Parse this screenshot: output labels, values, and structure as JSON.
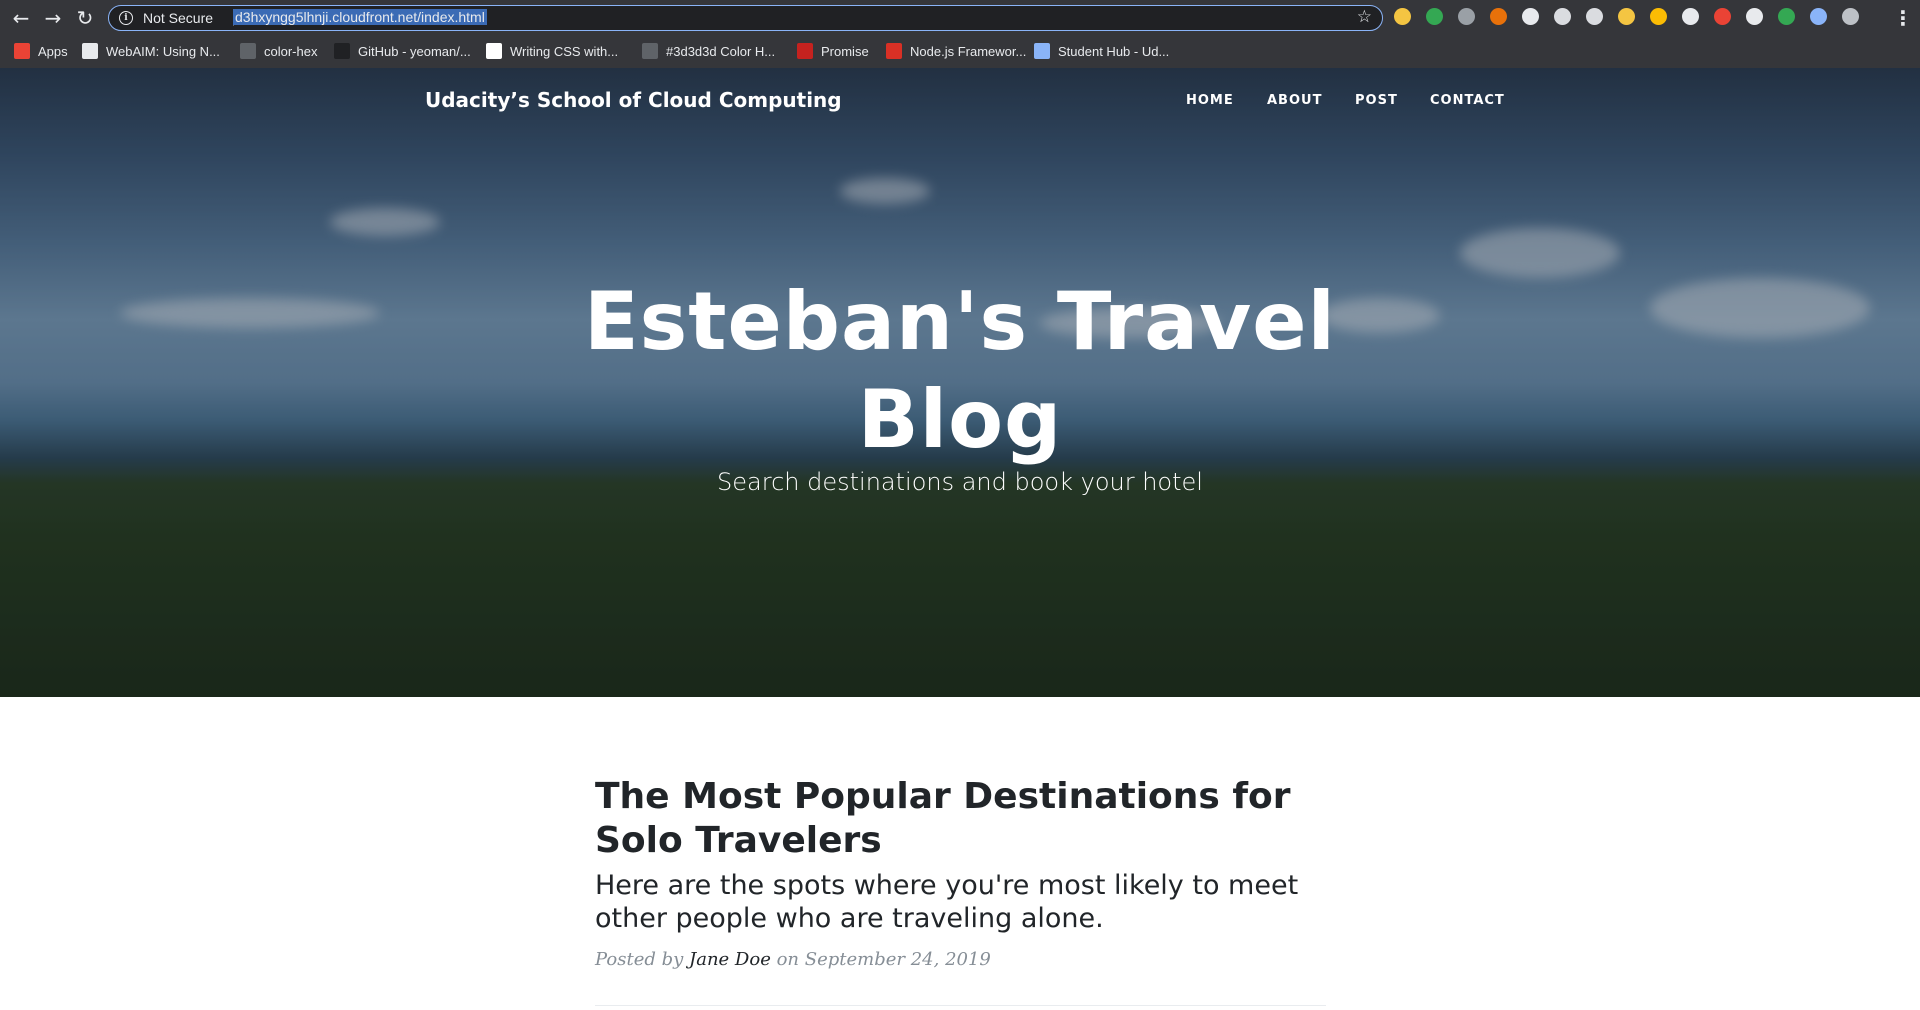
{
  "browser": {
    "security_label": "Not Secure",
    "url": "d3hxyngg5lhnji.cloudfront.net/index.html",
    "icons": {
      "back": "arrow-left-icon",
      "forward": "arrow-right-icon",
      "reload": "reload-icon",
      "info": "info-icon",
      "star": "star-icon",
      "menu": "more-vert-icon"
    },
    "extensions": [
      "#f4c542",
      "#34a853",
      "#9aa0a6",
      "#e8710a",
      "#e8eaed",
      "#dadce0",
      "#dadce0",
      "#f4c542",
      "#fbbc04",
      "#e8eaed",
      "#ea4335",
      "#e8eaed",
      "#34a853",
      "#8ab4f8",
      "#bdc1c6"
    ],
    "bookmarks": [
      {
        "label": "Apps",
        "icon": "apps-grid-icon",
        "color": "#ea4335"
      },
      {
        "label": "WebAIM: Using N...",
        "icon": "webaim-icon",
        "color": "#e8eaed"
      },
      {
        "label": "color-hex",
        "icon": "color-hex-icon",
        "color": "#5f6368"
      },
      {
        "label": "GitHub - yeoman/...",
        "icon": "github-icon",
        "color": "#202124"
      },
      {
        "label": "Writing CSS with...",
        "icon": "medium-icon",
        "color": "#ffffff"
      },
      {
        "label": "#3d3d3d Color H...",
        "icon": "color-hex-icon",
        "color": "#5f6368"
      },
      {
        "label": "Promise",
        "icon": "promise-icon",
        "color": "#c5221f"
      },
      {
        "label": "Node.js Framewor...",
        "icon": "node-framework-icon",
        "color": "#d93025"
      },
      {
        "label": "Student Hub - Ud...",
        "icon": "udacity-icon",
        "color": "#8ab4f8"
      }
    ]
  },
  "site": {
    "brand": "Udacity’s School of Cloud Computing",
    "nav": [
      "HOME",
      "ABOUT",
      "POST",
      "CONTACT"
    ],
    "hero": {
      "title": "Esteban's Travel Blog",
      "subtitle": "Search destinations and book your hotel"
    }
  },
  "post": {
    "title": "The Most Popular Destinations for Solo Travelers",
    "subtitle": "Here are the spots where you're most likely to meet other people who are traveling alone.",
    "meta_prefix": "Posted by",
    "author": "Jane Doe",
    "meta_on": "on",
    "date": "September 24, 2019"
  }
}
